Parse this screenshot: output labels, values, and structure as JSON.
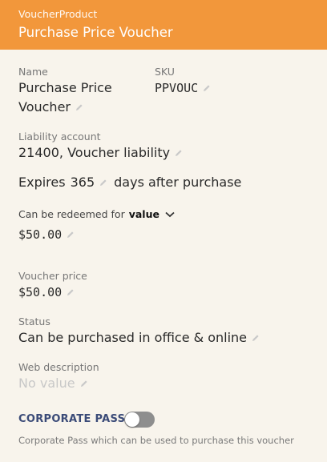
{
  "header": {
    "type_label": "VoucherProduct",
    "title": "Purchase Price Voucher"
  },
  "fields": {
    "name": {
      "label": "Name",
      "value_line1": "Purchase Price",
      "value_line2": "Voucher"
    },
    "sku": {
      "label": "SKU",
      "value": "PPVOUC"
    },
    "liability": {
      "label": "Liability account",
      "value": "21400, Voucher liability"
    },
    "expires": {
      "prefix": "Expires",
      "days": "365",
      "suffix": "days after purchase"
    },
    "redeem": {
      "label": "Can be redeemed for",
      "mode": "value",
      "amount": "$50.00"
    },
    "price": {
      "label": "Voucher price",
      "value": "$50.00"
    },
    "status": {
      "label": "Status",
      "value": "Can be purchased in office & online"
    },
    "web_description": {
      "label": "Web description",
      "value": "No value"
    }
  },
  "corporate_pass": {
    "label": "CORPORATE PASS",
    "enabled": false,
    "description": "Corporate Pass which can be used to purchase this voucher"
  },
  "icons": {
    "edit": "pencil-icon",
    "dropdown": "chevron-down-icon"
  },
  "colors": {
    "header": "#f2973b",
    "background": "#f8f4ec",
    "corporate_label": "#3b4b78"
  }
}
